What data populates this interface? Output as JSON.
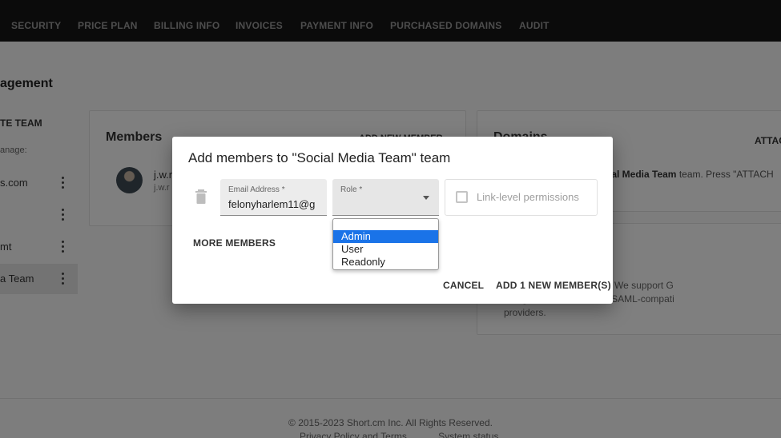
{
  "nav": {
    "items": [
      "SECURITY",
      "PRICE PLAN",
      "BILLING INFO",
      "INVOICES",
      "PAYMENT INFO",
      "PURCHASED DOMAINS",
      "AUDIT"
    ]
  },
  "page": {
    "title": "agement",
    "sidebar": {
      "heading": "TE TEAM",
      "subheading": "anage:",
      "teams": [
        {
          "name": "s.com"
        },
        {
          "name": ""
        },
        {
          "name": "mt"
        },
        {
          "name": "a Team"
        }
      ]
    },
    "members_card": {
      "title": "Members",
      "add_link": "ADD NEW MEMBER",
      "member_name": "j.w.r",
      "member_email": "j.w.r"
    },
    "domains_card": {
      "title": "Domains",
      "attach": "ATTAC",
      "text_bold": "ocial Media Team",
      "text_rest": " team. Press \"ATTACH"
    },
    "sso_card": {
      "line1": "m members in one place. We support G",
      "line2": "nelogin, ADFS and other SAML-compati",
      "line3": "providers."
    },
    "footer": {
      "copyright": "© 2015-2023  Short.cm Inc. All Rights Reserved.",
      "privacy": "Privacy Policy and Terms",
      "status": "System status"
    }
  },
  "dialog": {
    "title": "Add members to \"Social Media Team\" team",
    "email_label": "Email Address *",
    "email_value": "felonyharlem11@g",
    "role_label": "Role *",
    "role_options": [
      "Admin",
      "User",
      "Readonly"
    ],
    "role_selected": "Admin",
    "permissions_label": "Link-level permissions",
    "more_members": "MORE MEMBERS",
    "cancel": "CANCEL",
    "add": "ADD 1 NEW MEMBER(S)"
  },
  "colors": {
    "nav_bg": "#171717",
    "selection": "#1a73e8",
    "overlay": "rgba(0,0,0,0.5)"
  }
}
